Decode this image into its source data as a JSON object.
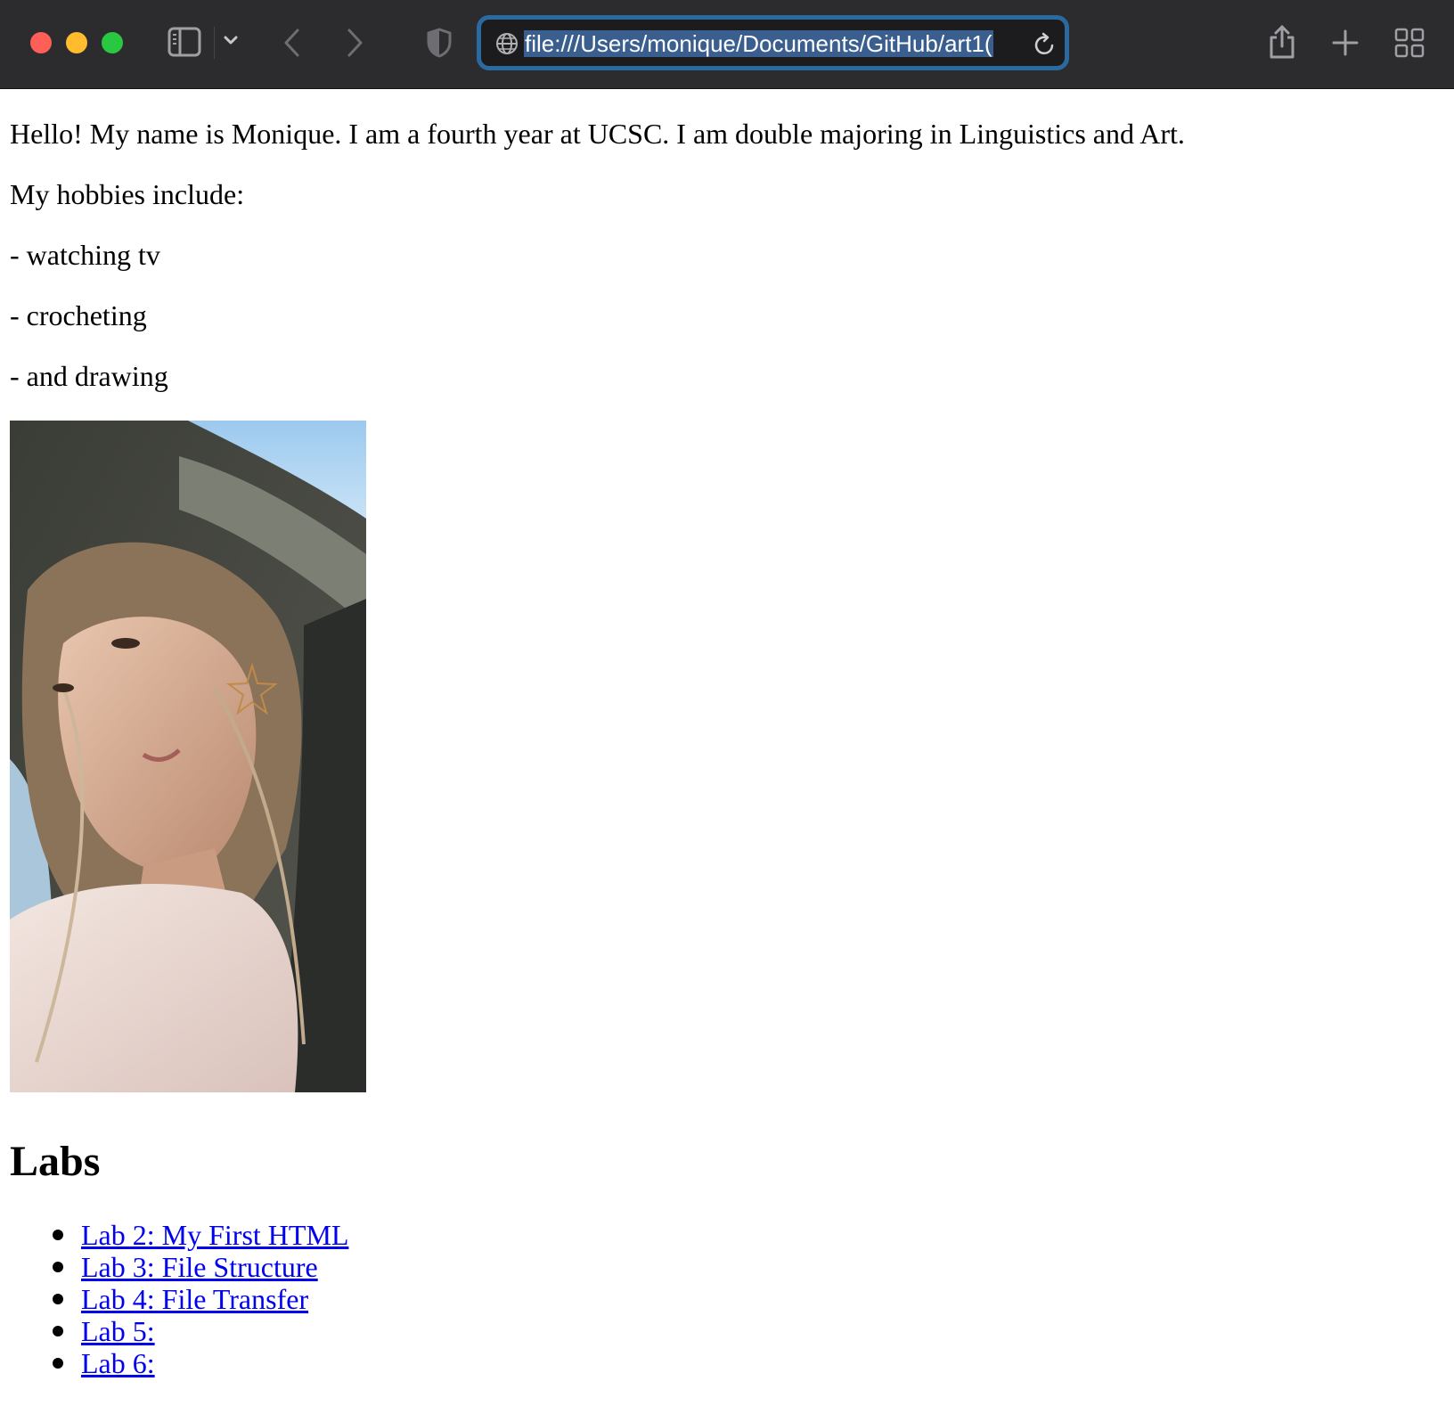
{
  "browser": {
    "url": "file:///Users/monique/Documents/GitHub/art1(",
    "icons": {
      "close": "close-traffic-light",
      "minimize": "minimize-traffic-light",
      "zoom": "zoom-traffic-light",
      "sidebar": "sidebar-icon",
      "sidebar_menu": "chevron-down-icon",
      "back": "chevron-left-icon",
      "forward": "chevron-right-icon",
      "privacy": "shield-icon",
      "site": "globe-icon",
      "reload": "reload-icon",
      "share": "share-icon",
      "new_tab": "plus-icon",
      "tab_overview": "grid-icon"
    },
    "colors": {
      "toolbar": "#2c2c2e",
      "url_focus_ring": "#2a6aa0",
      "close": "#ff5f57",
      "minimize": "#febc2e",
      "zoom": "#28c840"
    }
  },
  "page": {
    "intro": "Hello! My name is Monique. I am a fourth year at UCSC. I am double majoring in Linguistics and Art.",
    "hobbies_heading": "My hobbies include:",
    "hobbies": [
      "- watching tv",
      "- crocheting",
      "- and drawing"
    ],
    "labs_heading": "Labs",
    "labs": [
      "Lab 2: My First HTML",
      "Lab 3: File Structure",
      "Lab 4: File Transfer",
      "Lab 5:",
      "Lab 6:"
    ],
    "link_color": "#0000ee"
  }
}
